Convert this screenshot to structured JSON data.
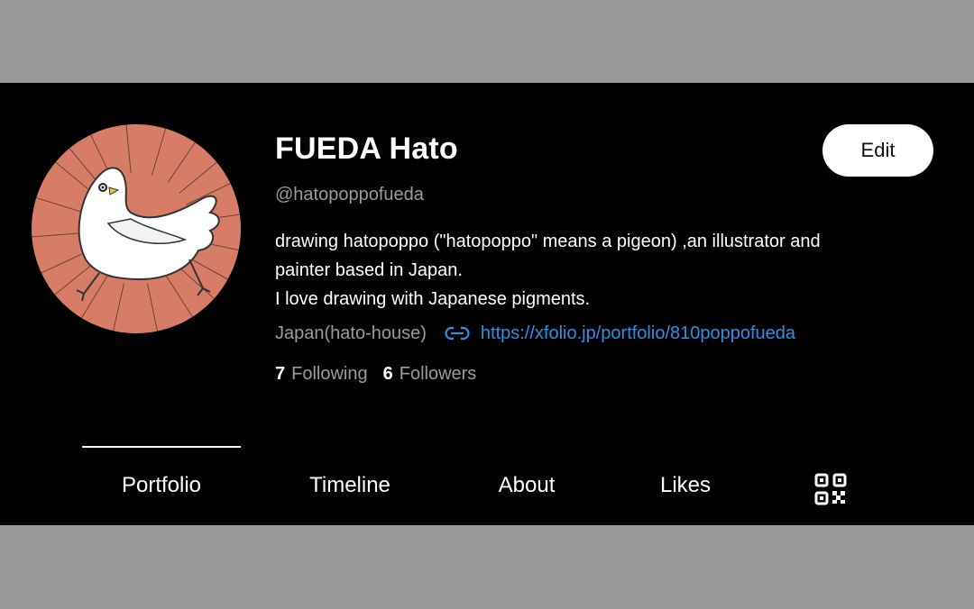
{
  "profile": {
    "name": "FUEDA Hato",
    "handle": "@hatopoppofueda",
    "bio_lines": [
      "drawing hatopoppo (\"hatopoppo\" means a pigeon) ,an illustrator and",
      "painter based in Japan.",
      "I love drawing with Japanese pigments."
    ],
    "location": "Japan(hato-house)",
    "link": "https://xfolio.jp/portfolio/810poppofueda",
    "following_count": "7",
    "following_label": "Following",
    "followers_count": "6",
    "followers_label": "Followers",
    "avatar_icon": "pigeon-illustration"
  },
  "actions": {
    "edit_label": "Edit"
  },
  "tabs": [
    {
      "label": "Portfolio",
      "active": true
    },
    {
      "label": "Timeline",
      "active": false
    },
    {
      "label": "About",
      "active": false
    },
    {
      "label": "Likes",
      "active": false
    }
  ],
  "icons": {
    "link": "link-icon",
    "qr": "qr-code-icon"
  },
  "colors": {
    "background": "#000000",
    "letterbox": "#999999",
    "text_primary": "#ffffff",
    "text_secondary": "#9a9a9a",
    "link": "#2f8fe0",
    "avatar_bg": "#d77d67",
    "button_bg": "#ffffff"
  }
}
